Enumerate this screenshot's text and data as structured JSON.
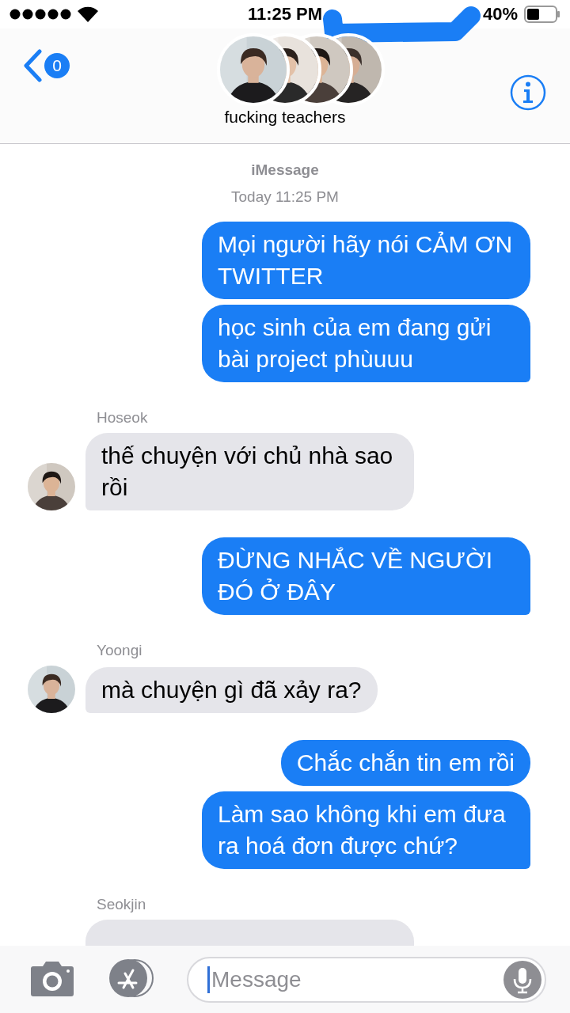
{
  "status_bar": {
    "time": "11:25 PM",
    "battery": "40%"
  },
  "header": {
    "unread_count": "0",
    "title": "fucking teachers"
  },
  "thread": {
    "service": "iMessage",
    "timestamp": "Today 11:25 PM"
  },
  "messages": [
    {
      "kind": "sent",
      "text": "Mọi người hãy nói CẢM ƠN TWITTER"
    },
    {
      "kind": "sent",
      "text": "học sinh của em đang gửi bài project phùuuu"
    },
    {
      "kind": "received",
      "sender": "Hoseok",
      "text": "thế chuyện với chủ nhà sao rồi"
    },
    {
      "kind": "sent",
      "text": "ĐỪNG NHẮC VỀ NGƯỜI ĐÓ Ở ĐÂY"
    },
    {
      "kind": "received",
      "sender": "Yoongi",
      "text": "mà chuyện gì đã xảy ra?"
    },
    {
      "kind": "sent",
      "text": "Chắc chắn tin em rồi"
    },
    {
      "kind": "sent",
      "text": "Làm sao không khi em đưa ra hoá đơn được chứ?"
    },
    {
      "kind": "received",
      "sender": "Seokjin"
    }
  ],
  "composer": {
    "placeholder": "Message"
  }
}
